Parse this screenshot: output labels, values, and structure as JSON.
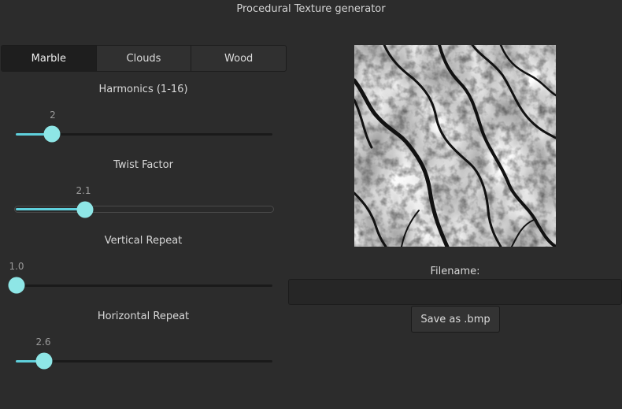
{
  "window": {
    "title": "Procedural Texture generator"
  },
  "tabs": [
    {
      "label": "Marble",
      "active": true
    },
    {
      "label": "Clouds",
      "active": false
    },
    {
      "label": "Wood",
      "active": false
    }
  ],
  "sliders": {
    "harmonics": {
      "label": "Harmonics (1-16)",
      "value": "2",
      "fraction": 0.14
    },
    "twist": {
      "label": "Twist Factor",
      "value": "2.1",
      "fraction": 0.27
    },
    "vertical": {
      "label": "Vertical Repeat",
      "value": "1.0",
      "fraction": 0.0
    },
    "horizontal": {
      "label": "Horizontal Repeat",
      "value": "2.6",
      "fraction": 0.11
    }
  },
  "accent_color": "#5fd0dc",
  "handle_color": "#8ee6e6",
  "filename": {
    "label": "Filename:",
    "value": "",
    "placeholder": ""
  },
  "save_button": {
    "label": "Save as .bmp"
  }
}
